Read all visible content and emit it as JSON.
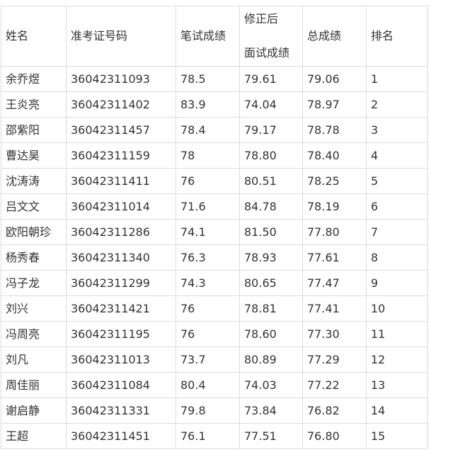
{
  "table": {
    "headers": {
      "name": "姓名",
      "exam_id": "准考证号码",
      "written": "笔试成绩",
      "interview_line1": "修正后",
      "interview_line2": "面试成绩",
      "total": "总成绩",
      "rank": "排名"
    },
    "rows": [
      {
        "name": "余乔煜",
        "exam_id": "36042311093",
        "written": "78.5",
        "interview": "79.61",
        "total": "79.06",
        "rank": "1"
      },
      {
        "name": "王炎亮",
        "exam_id": "36042311402",
        "written": "83.9",
        "interview": "74.04",
        "total": "78.97",
        "rank": "2"
      },
      {
        "name": "邵紫阳",
        "exam_id": "36042311457",
        "written": "78.4",
        "interview": "79.17",
        "total": "78.78",
        "rank": "3"
      },
      {
        "name": "曹达昊",
        "exam_id": "36042311159",
        "written": "78",
        "interview": "78.80",
        "total": "78.40",
        "rank": "4"
      },
      {
        "name": "沈涛涛",
        "exam_id": "36042311411",
        "written": "76",
        "interview": "80.51",
        "total": "78.25",
        "rank": "5"
      },
      {
        "name": "吕文文",
        "exam_id": "36042311014",
        "written": "71.6",
        "interview": "84.78",
        "total": "78.19",
        "rank": "6"
      },
      {
        "name": "欧阳朝珍",
        "exam_id": "36042311286",
        "written": "74.1",
        "interview": "81.50",
        "total": "77.80",
        "rank": "7"
      },
      {
        "name": "杨秀春",
        "exam_id": "36042311340",
        "written": "76.3",
        "interview": "78.93",
        "total": "77.61",
        "rank": "8"
      },
      {
        "name": "冯子龙",
        "exam_id": "36042311299",
        "written": "74.3",
        "interview": "80.65",
        "total": "77.47",
        "rank": "9"
      },
      {
        "name": "刘兴",
        "exam_id": "36042311421",
        "written": "76",
        "interview": "78.81",
        "total": "77.41",
        "rank": "10"
      },
      {
        "name": "冯周亮",
        "exam_id": "36042311195",
        "written": "76",
        "interview": "78.60",
        "total": "77.30",
        "rank": "11"
      },
      {
        "name": "刘凡",
        "exam_id": "36042311013",
        "written": "73.7",
        "interview": "80.89",
        "total": "77.29",
        "rank": "12"
      },
      {
        "name": "周佳丽",
        "exam_id": "36042311084",
        "written": "80.4",
        "interview": "74.03",
        "total": "77.22",
        "rank": "13"
      },
      {
        "name": "谢启静",
        "exam_id": "36042311331",
        "written": "79.8",
        "interview": "73.84",
        "total": "76.82",
        "rank": "14"
      },
      {
        "name": "王超",
        "exam_id": "36042311451",
        "written": "76.1",
        "interview": "77.51",
        "total": "76.80",
        "rank": "15"
      }
    ]
  }
}
